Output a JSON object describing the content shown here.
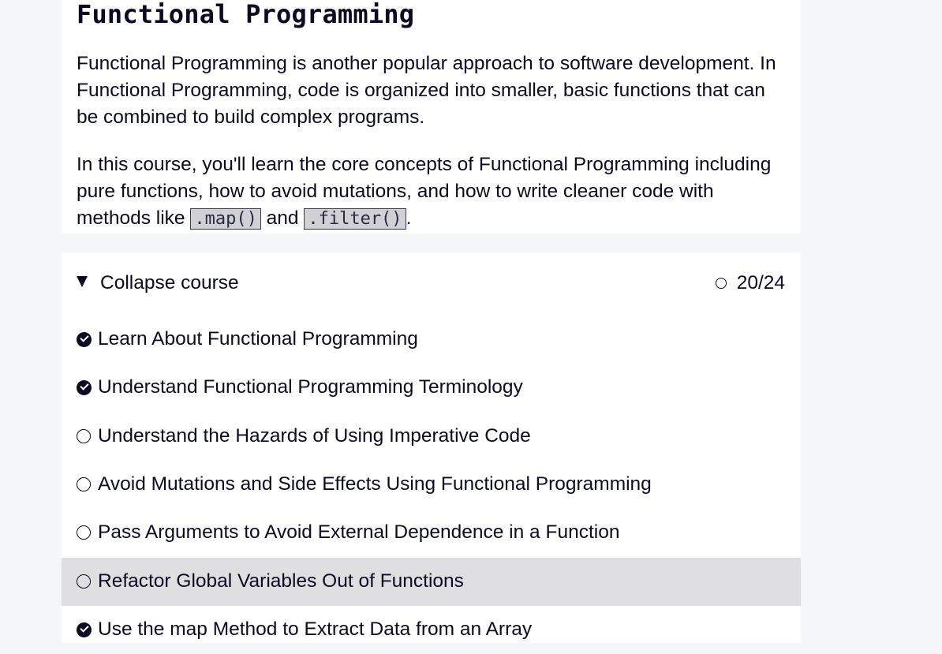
{
  "course": {
    "title": "Functional Programming",
    "description_1": "Functional Programming is another popular approach to software development. In Functional Programming, code is organized into smaller, basic functions that can be combined to build complex programs.",
    "description_2_pre": "In this course, you'll learn the core concepts of Functional Programming including pure functions, how to avoid mutations, and how to write cleaner code with methods like ",
    "code_1": ".map()",
    "description_2_mid": " and ",
    "code_2": ".filter()",
    "description_2_post": "."
  },
  "block": {
    "collapse_label": "Collapse course",
    "progress": "20/24",
    "steps": [
      {
        "label": "Learn About Functional Programming",
        "icon": "check-circle-icon",
        "completed": true
      },
      {
        "label": "Understand Functional Programming Terminology",
        "icon": "check-circle-icon",
        "completed": true
      },
      {
        "label": "Understand the Hazards of Using Imperative Code",
        "icon": "empty-circle-icon",
        "completed": false
      },
      {
        "label": "Avoid Mutations and Side Effects Using Functional Programming",
        "icon": "empty-circle-icon",
        "completed": false
      },
      {
        "label": "Pass Arguments to Avoid External Dependence in a Function",
        "icon": "empty-circle-icon",
        "completed": false
      },
      {
        "label": "Refactor Global Variables Out of Functions",
        "icon": "empty-circle-icon",
        "completed": false,
        "highlighted": true
      },
      {
        "label": "Use the map Method to Extract Data from an Array",
        "icon": "check-circle-icon",
        "completed": true
      }
    ]
  },
  "colors": {
    "page_background": "#f5f6f7",
    "panel_background": "#ffffff",
    "highlight_row": "#dfdfe2",
    "text": "#0a0a23",
    "code_background": "#d0d0d5"
  }
}
